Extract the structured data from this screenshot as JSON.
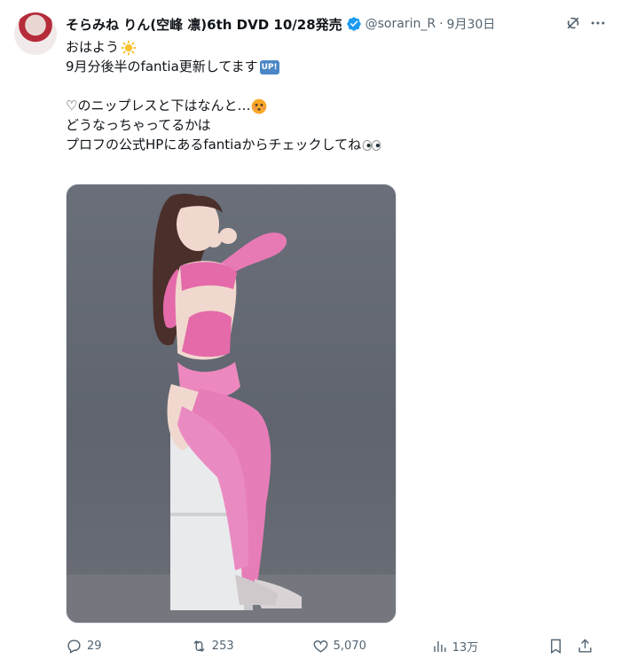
{
  "tweet": {
    "author_name": "そらみね りん(空峰 凛)6th DVD 10/28発売",
    "handle": "@sorarin_R",
    "separator": "·",
    "date": "9月30日",
    "lines": [
      "おはよう",
      "9月分後半のfantia更新してます",
      "",
      "♡のニップレスと下はなんと…",
      "どうなっちゃってるかは",
      "プロフの公式HPにあるfantiaからチェックしてね"
    ],
    "up_badge": "UP!"
  },
  "actions": {
    "reply_count": "29",
    "retweet_count": "253",
    "like_count": "5,070",
    "views_count": "13万"
  },
  "colors": {
    "verified": "#1d9bf0",
    "text_secondary": "#536471"
  },
  "icons": {
    "verified": "verified-badge-icon",
    "grok": "grok-icon",
    "more": "more-icon",
    "reply": "reply-icon",
    "retweet": "retweet-icon",
    "like": "like-icon",
    "views": "views-icon",
    "bookmark": "bookmark-icon",
    "share": "share-icon"
  }
}
